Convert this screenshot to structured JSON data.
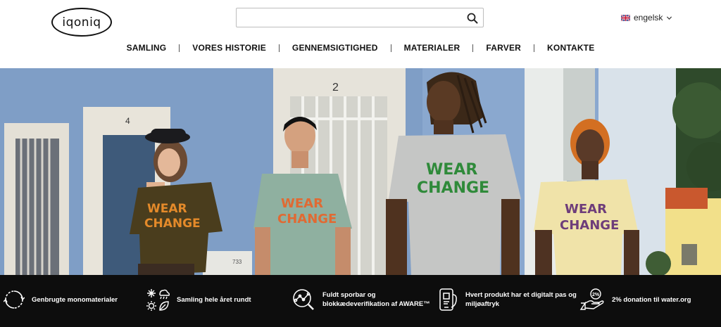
{
  "brand": {
    "logo_text": "iqoniq"
  },
  "search": {
    "placeholder": "",
    "value": ""
  },
  "language": {
    "label": "engelsk",
    "flag_icon": "uk-flag-icon"
  },
  "nav": {
    "items": [
      {
        "label": "SAMLING"
      },
      {
        "label": "VORES HISTORIE"
      },
      {
        "label": "GENNEMSIGTIGHED"
      },
      {
        "label": "MATERIALER"
      },
      {
        "label": "FARVER"
      },
      {
        "label": "KONTAKTE"
      }
    ]
  },
  "hero": {
    "door_number_left": "4",
    "door_number_right": "2",
    "shirt_text_line1": "WEAR",
    "shirt_text_line2": "CHANGE",
    "meter_text": "733",
    "shirt_colors": [
      "#4a3d1d",
      "#8fb0a0",
      "#c5c6c5",
      "#f0e3a9"
    ],
    "print_colors": [
      "#e48a2a",
      "#e06a33",
      "#2f8a3a",
      "#6e3d7a"
    ]
  },
  "features": [
    {
      "icon": "recycle-icon",
      "text": "Genbrugte monomaterialer"
    },
    {
      "icon": "seasons-icon",
      "text": "Samling hele året rundt"
    },
    {
      "icon": "traceability-icon",
      "text": "Fuldt sporbar og\nblokkædeverifikation af AWARE™"
    },
    {
      "icon": "digital-passport-icon",
      "text": "Hvert produkt har et digitalt pas og\nmiljøaftryk"
    },
    {
      "icon": "donation-hand-icon",
      "text": "2% donation til water.org",
      "badge": "2%"
    }
  ]
}
